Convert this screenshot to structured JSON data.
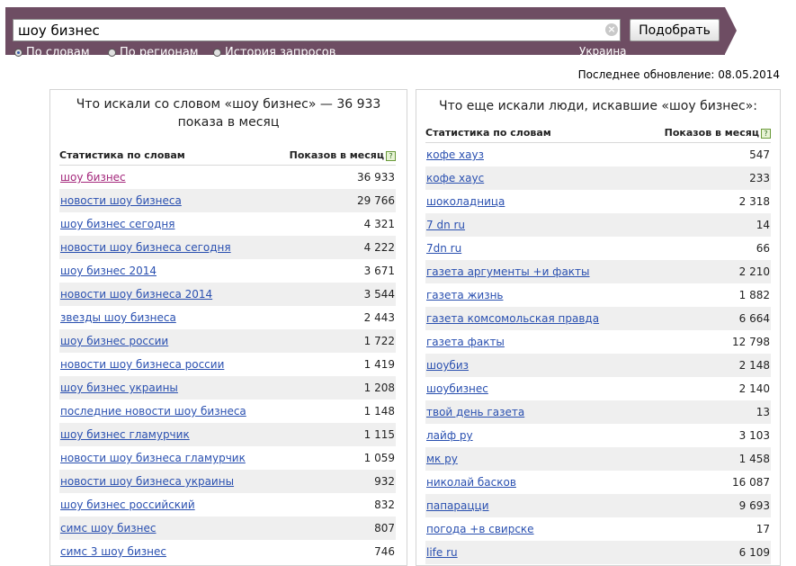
{
  "search": {
    "query": "шоу бизнес",
    "clear_glyph": "×",
    "submit_label": "Подобрать"
  },
  "filters": [
    {
      "label": "По словам",
      "checked": true
    },
    {
      "label": "По регионам",
      "checked": false
    },
    {
      "label": "История запросов",
      "checked": false
    }
  ],
  "region": "Украина",
  "last_update": "Последнее обновление: 08.05.2014",
  "left_panel": {
    "title": "Что искали со словом «шоу бизнес» — 36 933 показа в месяц",
    "col_phrase": "Статистика по словам",
    "col_count": "Показов в месяц",
    "help_glyph": "?",
    "rows": [
      {
        "phrase": "шоу бизнес",
        "count": "36 933"
      },
      {
        "phrase": "новости шоу бизнеса",
        "count": "29 766"
      },
      {
        "phrase": "шоу бизнес сегодня",
        "count": "4 321"
      },
      {
        "phrase": "новости шоу бизнеса сегодня",
        "count": "4 222"
      },
      {
        "phrase": "шоу бизнес 2014",
        "count": "3 671"
      },
      {
        "phrase": "новости шоу бизнеса 2014",
        "count": "3 544"
      },
      {
        "phrase": "звезды шоу бизнеса",
        "count": "2 443"
      },
      {
        "phrase": "шоу бизнес россии",
        "count": "1 722"
      },
      {
        "phrase": "новости шоу бизнеса россии",
        "count": "1 419"
      },
      {
        "phrase": "шоу бизнес украины",
        "count": "1 208"
      },
      {
        "phrase": "последние новости шоу бизнеса",
        "count": "1 148"
      },
      {
        "phrase": "шоу бизнес гламурчик",
        "count": "1 115"
      },
      {
        "phrase": "новости шоу бизнеса гламурчик",
        "count": "1 059"
      },
      {
        "phrase": "новости шоу бизнеса украины",
        "count": "932"
      },
      {
        "phrase": "шоу бизнес российский",
        "count": "832"
      },
      {
        "phrase": "симс шоу бизнес",
        "count": "807"
      },
      {
        "phrase": "симс 3 шоу бизнес",
        "count": "746"
      }
    ]
  },
  "right_panel": {
    "title": "Что еще искали люди, искавшие «шоу бизнес»:",
    "col_phrase": "Статистика по словам",
    "col_count": "Показов в месяц",
    "help_glyph": "?",
    "rows": [
      {
        "phrase": "кофе хауз",
        "count": "547"
      },
      {
        "phrase": "кофе хаус",
        "count": "233"
      },
      {
        "phrase": "шоколадница",
        "count": "2 318"
      },
      {
        "phrase": "7 dn ru",
        "count": "14"
      },
      {
        "phrase": "7dn ru",
        "count": "66"
      },
      {
        "phrase": "газета аргументы +и факты",
        "count": "2 210"
      },
      {
        "phrase": "газета жизнь",
        "count": "1 882"
      },
      {
        "phrase": "газета комсомольская правда",
        "count": "6 664"
      },
      {
        "phrase": "газета факты",
        "count": "12 798"
      },
      {
        "phrase": "шоубиз",
        "count": "2 148"
      },
      {
        "phrase": "шоубизнес",
        "count": "2 140"
      },
      {
        "phrase": "твой день газета",
        "count": "13"
      },
      {
        "phrase": "лайф ру",
        "count": "3 103"
      },
      {
        "phrase": "мк ру",
        "count": "1 458"
      },
      {
        "phrase": "николай басков",
        "count": "16 087"
      },
      {
        "phrase": "папарацци",
        "count": "9 693"
      },
      {
        "phrase": "погода +в свирске",
        "count": "17"
      },
      {
        "phrase": "life ru",
        "count": "6 109"
      }
    ]
  }
}
